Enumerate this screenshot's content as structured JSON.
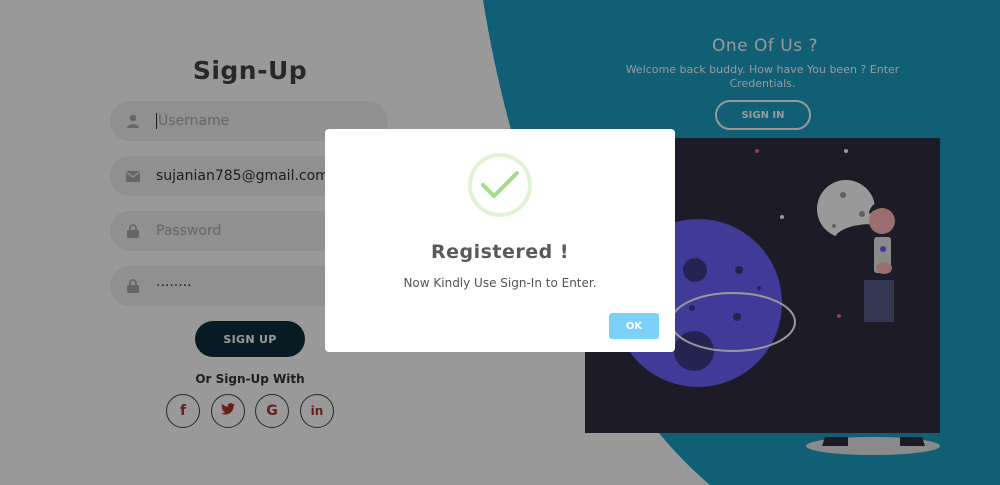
{
  "signup": {
    "title": "Sign-Up",
    "username": {
      "placeholder": "Username",
      "value": ""
    },
    "email": {
      "value": "sujanian785@gmail.com"
    },
    "password": {
      "placeholder": "Password"
    },
    "confirm_password": {
      "masked_value": "········"
    },
    "submit_label": "SIGN UP",
    "or_text": "Or Sign-Up With",
    "socials": [
      {
        "icon": "facebook-icon",
        "glyph": "f"
      },
      {
        "icon": "twitter-icon",
        "glyph": "🐦"
      },
      {
        "icon": "google-icon",
        "glyph": "G"
      },
      {
        "icon": "linkedin-icon",
        "glyph": "in"
      }
    ]
  },
  "panel": {
    "title": "One Of Us ?",
    "subtitle": "Welcome back buddy. How have You been ? Enter Credentials.",
    "signin_label": "SIGN IN"
  },
  "modal": {
    "title": "Registered !",
    "text": "Now Kindly Use Sign-In to Enter.",
    "ok_label": "OK",
    "icon": "success-check-icon"
  },
  "colors": {
    "panel_teal": "#1c9fc4",
    "signup_button": "#0d2d3f",
    "ok_button": "#7cd1f9",
    "check_green": "#a5dc86",
    "social_icon": "#b0332f"
  }
}
